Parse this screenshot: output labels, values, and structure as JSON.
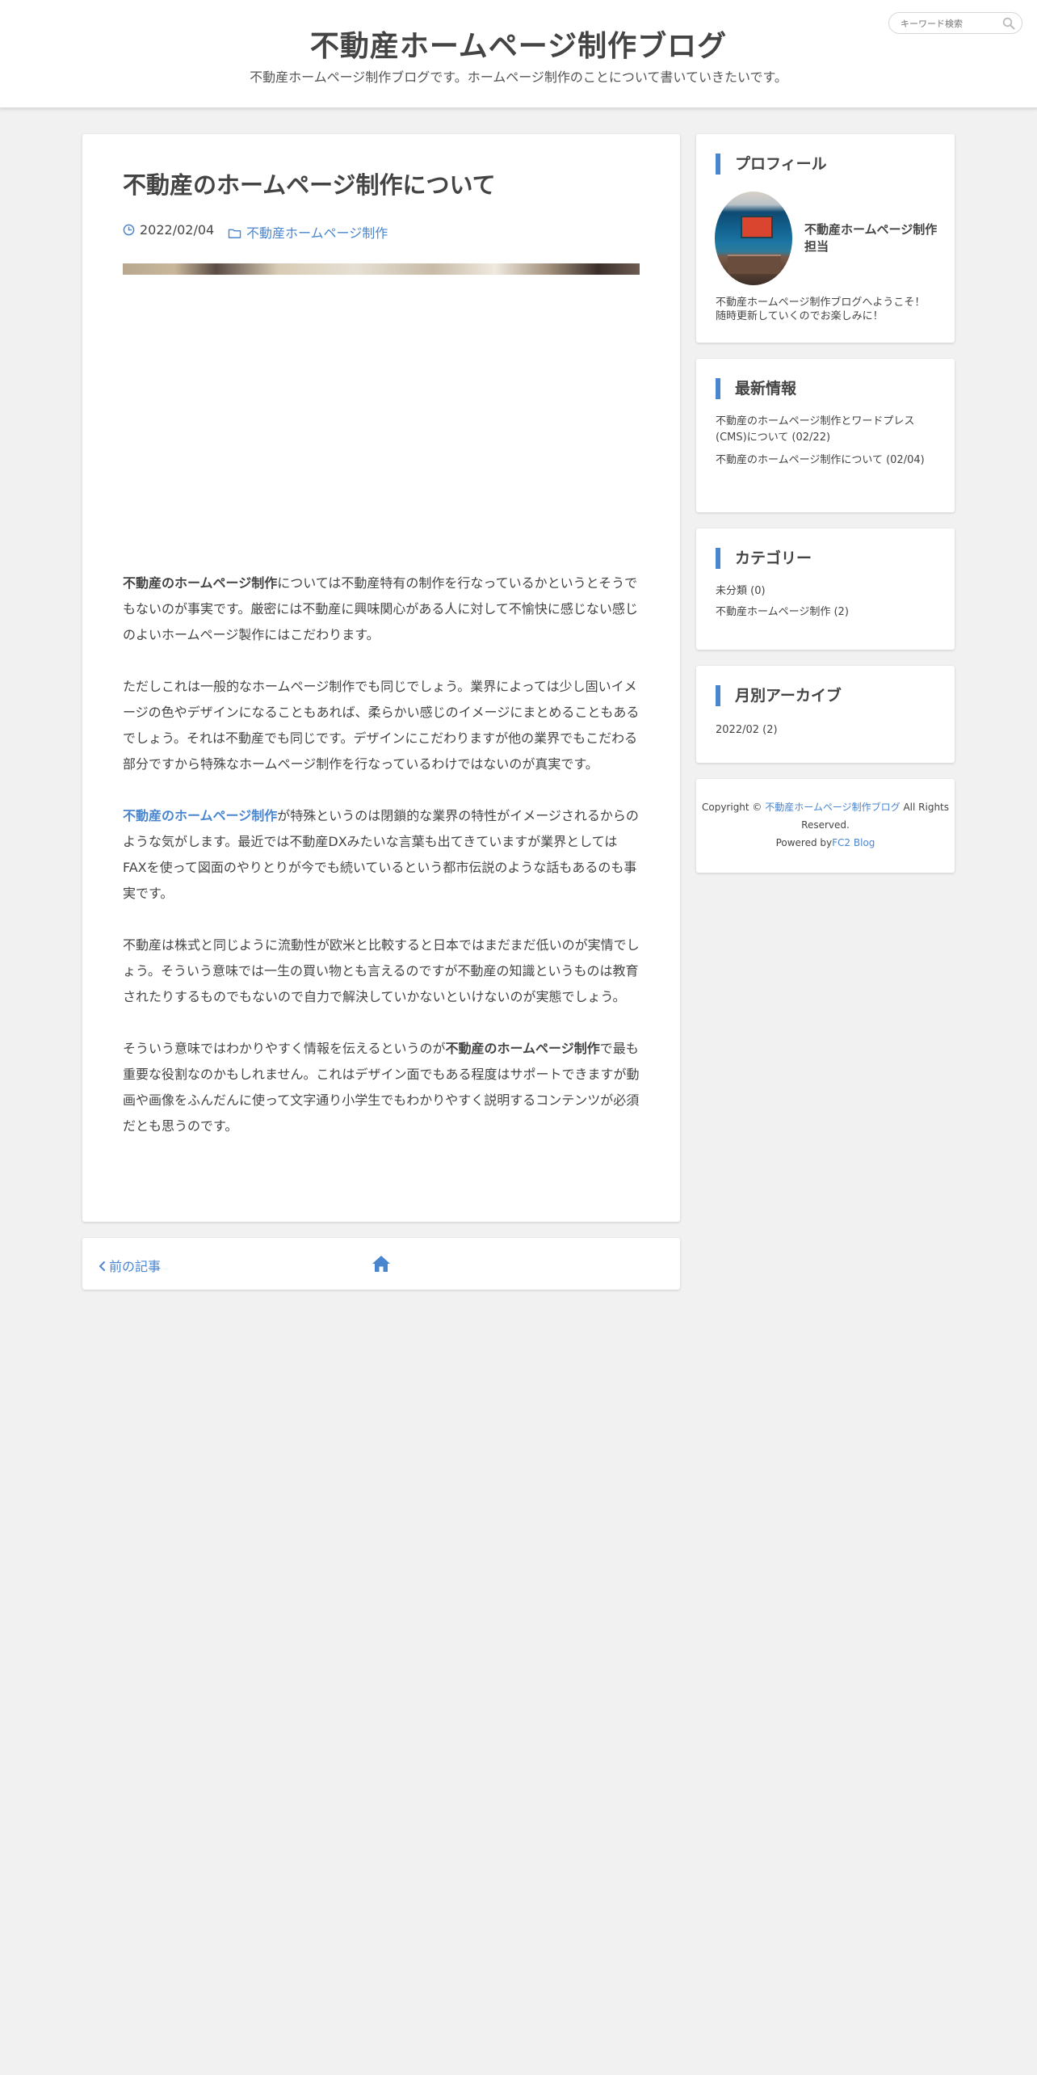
{
  "header": {
    "title": "不動産ホームページ制作ブログ",
    "description": "不動産ホームページ制作ブログです。ホームページ制作のことについて書いていきたいです。",
    "search_placeholder": "キーワード検索"
  },
  "article": {
    "title": "不動産のホームページ制作について",
    "date": "2022/02/04",
    "category": "不動産ホームページ制作",
    "paragraphs": [
      {
        "lead_bold": "不動産のホームページ制作",
        "text": "については不動産特有の制作を行なっているかというとそうでもないのが事実です。厳密には不動産に興味関心がある人に対して不愉快に感じない感じのよいホームページ製作にはこだわります。"
      },
      {
        "text": "ただしこれは一般的なホームページ制作でも同じでしょう。業界によっては少し固いイメージの色やデザインになることもあれば、柔らかい感じのイメージにまとめることもあるでしょう。それは不動産でも同じです。デザインにこだわりますが他の業界でもこだわる部分ですから特殊なホームページ制作を行なっているわけではないのが真実です。"
      },
      {
        "lead_link": "不動産のホームページ制作",
        "text": "が特殊というのは閉鎖的な業界の特性がイメージされるからのような気がします。最近では不動産DXみたいな言葉も出てきていますが業界としてはFAXを使って図面のやりとりが今でも続いているという都市伝説のような話もあるのも事実です。"
      },
      {
        "text": "不動産は株式と同じように流動性が欧米と比較すると日本ではまだまだ低いのが実情でしょう。そういう意味では一生の買い物とも言えるのですが不動産の知識というものは教育されたりするものでもないので自力で解決していかないといけないのが実態でしょう。"
      },
      {
        "pre": "そういう意味ではわかりやすく情報を伝えるというのが",
        "mid_bold": "不動産のホームページ制作",
        "text": "で最も重要な役割なのかもしれません。これはデザイン面でもある程度はサポートできますが動画や画像をふんだんに使って文字通り小学生でもわかりやすく説明するコンテンツが必須だとも思うのです。"
      }
    ]
  },
  "pager": {
    "prev_label": "前の記事"
  },
  "sidebar": {
    "profile": {
      "title": "プロフィール",
      "name": "不動産ホームページ制作担当",
      "text": "不動産ホームページ制作ブログへようこそ！随時更新していくのでお楽しみに！"
    },
    "latest": {
      "title": "最新情報",
      "items": [
        "不動産のホームページ制作とワードプレス(CMS)について (02/22)",
        "不動産のホームページ制作について (02/04)"
      ]
    },
    "categories": {
      "title": "カテゴリー",
      "items": [
        "未分類 (0)",
        "不動産ホームページ制作 (2)"
      ]
    },
    "archive": {
      "title": "月別アーカイブ",
      "items": [
        "2022/02 (2)"
      ]
    },
    "copyright": {
      "prefix": "Copyright © ",
      "site_link": "不動産ホームページ制作ブログ",
      "suffix": " All Rights Reserved.",
      "powered_prefix": "Powered by",
      "powered_link": "FC2 Blog"
    }
  },
  "colors": {
    "accent": "#4a86cf",
    "background": "#f1f1f1"
  }
}
